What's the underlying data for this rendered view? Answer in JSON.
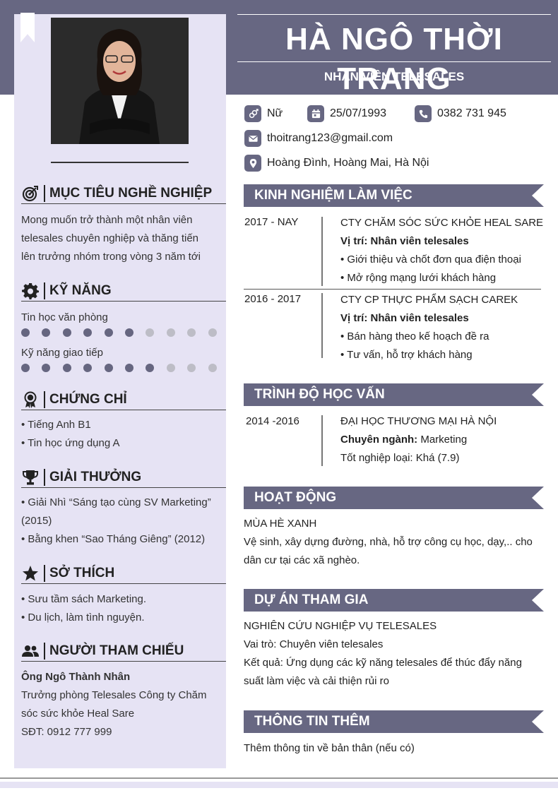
{
  "header": {
    "name": "HÀ NGÔ THỜI TRANG",
    "role": "NHÂN VIÊN TELESALES"
  },
  "contact": {
    "gender": "Nữ",
    "birthday": "25/07/1993",
    "phone": "0382 731 945",
    "email": "thoitrang123@gmail.com",
    "address": "Hoàng Đình, Hoàng Mai, Hà Nội"
  },
  "sidebar": {
    "objective": {
      "title": "MỤC TIÊU NGHỀ NGHIỆP",
      "lines": [
        "Mong muốn trở thành một nhân viên",
        "telesales chuyên nghiệp và thăng tiến",
        "lên trưởng nhóm trong vòng 3 năm tới"
      ]
    },
    "skills": {
      "title": "KỸ NĂNG",
      "items": [
        {
          "label": "Tin học văn phòng",
          "level": 6,
          "max": 10
        },
        {
          "label": "Kỹ năng giao tiếp",
          "level": 7,
          "max": 10
        }
      ]
    },
    "certificates": {
      "title": "CHỨNG CHỈ",
      "items": [
        "• Tiếng Anh B1",
        "• Tin học ứng dụng A"
      ]
    },
    "awards": {
      "title": "GIẢI THƯỞNG",
      "lines": [
        "• Giải Nhì “Sáng tạo cùng SV Marketing”",
        "(2015)",
        "• Bằng khen “Sao Tháng Giêng” (2012)"
      ]
    },
    "hobbies": {
      "title": "SỞ THÍCH",
      "items": [
        "• Sưu tầm sách Marketing.",
        "• Du lịch, làm tình nguyện."
      ]
    },
    "references": {
      "title": "NGƯỜI THAM CHIẾU",
      "name": "Ông Ngô Thành Nhân",
      "lines": [
        "Trưởng phòng Telesales Công ty Chăm",
        "sóc sức khỏe Heal Sare"
      ],
      "phone": "SĐT: 0912 777 999"
    }
  },
  "experience": {
    "title": "KINH NGHIỆM LÀM VIỆC",
    "jobs": [
      {
        "period": "2017 - NAY",
        "company": "CTY CHĂM SÓC SỨC KHỎE HEAL SARE",
        "position": "Vị trí: Nhân viên telesales",
        "tasks": [
          "• Giới thiệu và chốt đơn qua điện thoại",
          "• Mở rộng mạng lưới khách hàng"
        ]
      },
      {
        "period": "2016 - 2017",
        "company": "CTY CP THỰC PHẨM SẠCH CAREK",
        "position": "Vị trí: Nhân viên telesales",
        "tasks": [
          "• Bán hàng theo kế hoạch đề ra",
          "• Tư vấn, hỗ trợ khách hàng"
        ]
      }
    ]
  },
  "education": {
    "title": "TRÌNH ĐỘ HỌC VẤN",
    "period": "2014 -2016",
    "school": "ĐẠI HỌC THƯƠNG MẠI HÀ NỘI",
    "major_label": "Chuyên ngành:",
    "major": " Marketing",
    "result": "Tốt nghiệp loại: Khá (7.9)"
  },
  "activities": {
    "title": "HOẠT ĐỘNG",
    "name": "MÙA HÈ XANH",
    "lines": [
      "Vệ sinh, xây dựng đường, nhà, hỗ trợ công cụ học, dạy,.. cho",
      "dân cư tại các xã nghèo."
    ]
  },
  "projects": {
    "title": "DỰ ÁN THAM GIA",
    "name": "NGHIÊN CỨU NGHIỆP VỤ TELESALES",
    "role": "Vai trò: Chuyên viên telesales",
    "lines": [
      "Kết quả: Ứng dụng các kỹ năng telesales để thúc đẩy năng",
      "suất làm việc và cải thiện rủi ro"
    ]
  },
  "extra": {
    "title": "THÔNG TIN THÊM",
    "text": "Thêm thông tin về bản thân (nếu có)"
  },
  "colors": {
    "accent": "#676782",
    "sidebar": "#e6e3f4",
    "dot_on": "#666680",
    "dot_off": "#bdbdc6"
  }
}
